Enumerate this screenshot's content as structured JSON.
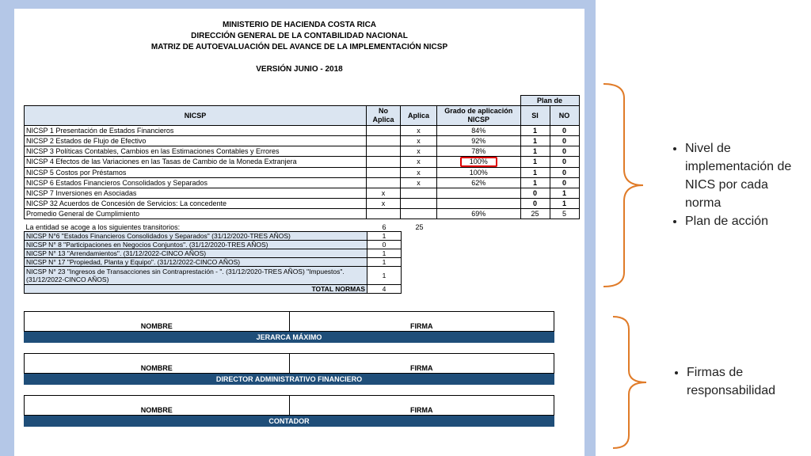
{
  "header": {
    "line1": "MINISTERIO DE HACIENDA COSTA RICA",
    "line2": "DIRECCIÓN GENERAL DE LA CONTABILIDAD NACIONAL",
    "line3": "MATRIZ DE AUTOEVALUACIÓN DEL AVANCE DE LA IMPLEMENTACIÓN NICSP",
    "version": "VERSIÓN JUNIO - 2018"
  },
  "table": {
    "plan_header": "Plan de",
    "col_nicsp": "NICSP",
    "col_no_aplica": "No Aplica",
    "col_aplica": "Aplica",
    "col_grado": "Grado de aplicación NICSP",
    "col_si": "SI",
    "col_no": "NO",
    "rows": [
      {
        "name": "NICSP 1 Presentación de Estados Financieros",
        "no_aplica": "",
        "aplica": "x",
        "grado": "84%",
        "si": "1",
        "no": "0"
      },
      {
        "name": "NICSP 2 Estados de Flujo de Efectivo",
        "no_aplica": "",
        "aplica": "x",
        "grado": "92%",
        "si": "1",
        "no": "0"
      },
      {
        "name": "NICSP 3 Políticas Contables, Cambios en las Estimaciones Contables y Errores",
        "no_aplica": "",
        "aplica": "x",
        "grado": "78%",
        "si": "1",
        "no": "0"
      },
      {
        "name": "NICSP 4  Efectos de las Variaciones en las Tasas de Cambio de la Moneda Extranjera",
        "no_aplica": "",
        "aplica": "x",
        "grado": "100%",
        "si": "1",
        "no": "0"
      },
      {
        "name": "NICSP 5 Costos por Préstamos",
        "no_aplica": "",
        "aplica": "x",
        "grado": "100%",
        "si": "1",
        "no": "0"
      },
      {
        "name": "NICSP 6  Estados Financieros Consolidados y Separados",
        "no_aplica": "",
        "aplica": "x",
        "grado": "62%",
        "si": "1",
        "no": "0"
      },
      {
        "name": "NICSP 7 Inversiones en Asociadas",
        "no_aplica": "x",
        "aplica": "",
        "grado": "",
        "si": "0",
        "no": "1"
      },
      {
        "name": "NICSP 32 Acuerdos de Concesión de Servicios: La concedente",
        "no_aplica": "x",
        "aplica": "",
        "grado": "",
        "si": "0",
        "no": "1"
      }
    ],
    "promedio_label": "Promedio General de Cumplimiento",
    "promedio_grado": "69%",
    "promedio_si": "25",
    "promedio_no": "5"
  },
  "transitorios": {
    "intro": "La entidad se acoge a los siguientes transitorios:",
    "intro_v1": "6",
    "intro_v2": "25",
    "rows": [
      {
        "text": "NICSP N°6 \"Estados Financieros Consolidados y Separados\" (31/12/2020-TRES AÑOS)",
        "value": "1"
      },
      {
        "text": "NICSP N° 8 \"Participaciones en Negocios Conjuntos\". (31/12/2020-TRES AÑOS)",
        "value": "0"
      },
      {
        "text": "NICSP N° 13 \"Arrendamientos\". (31/12/2022-CINCO AÑOS)",
        "value": "1"
      },
      {
        "text": "NICSP N° 17 \"Propiedad, Planta y Equipo\". (31/12/2022-CINCO AÑOS)",
        "value": "1"
      },
      {
        "text": "NICSP N° 23 \"Ingresos de Transacciones sin Contraprestación - \". (31/12/2020-TRES AÑOS) \"Impuestos\". (31/12/2022-CINCO AÑOS)",
        "value": "1"
      }
    ],
    "total_label": "TOTAL NORMAS",
    "total_value": "4"
  },
  "signatures": [
    {
      "nombre": "NOMBRE",
      "firma": "FIRMA",
      "role": "JERARCA MÁXIMO"
    },
    {
      "nombre": "NOMBRE",
      "firma": "FIRMA",
      "role": "DIRECTOR ADMINISTRATIVO FINANCIERO"
    },
    {
      "nombre": "NOMBRE",
      "firma": "FIRMA",
      "role": "CONTADOR"
    }
  ],
  "side": {
    "bullet1": "Nivel de implementación de NICS por cada norma",
    "bullet2": "Plan de acción",
    "bullet3": "Firmas de responsabilidad"
  },
  "colors": {
    "highlight": "#e00000",
    "brace": "#e07b28",
    "bar": "#1f4e79",
    "header_fill": "#dbe5f1"
  }
}
